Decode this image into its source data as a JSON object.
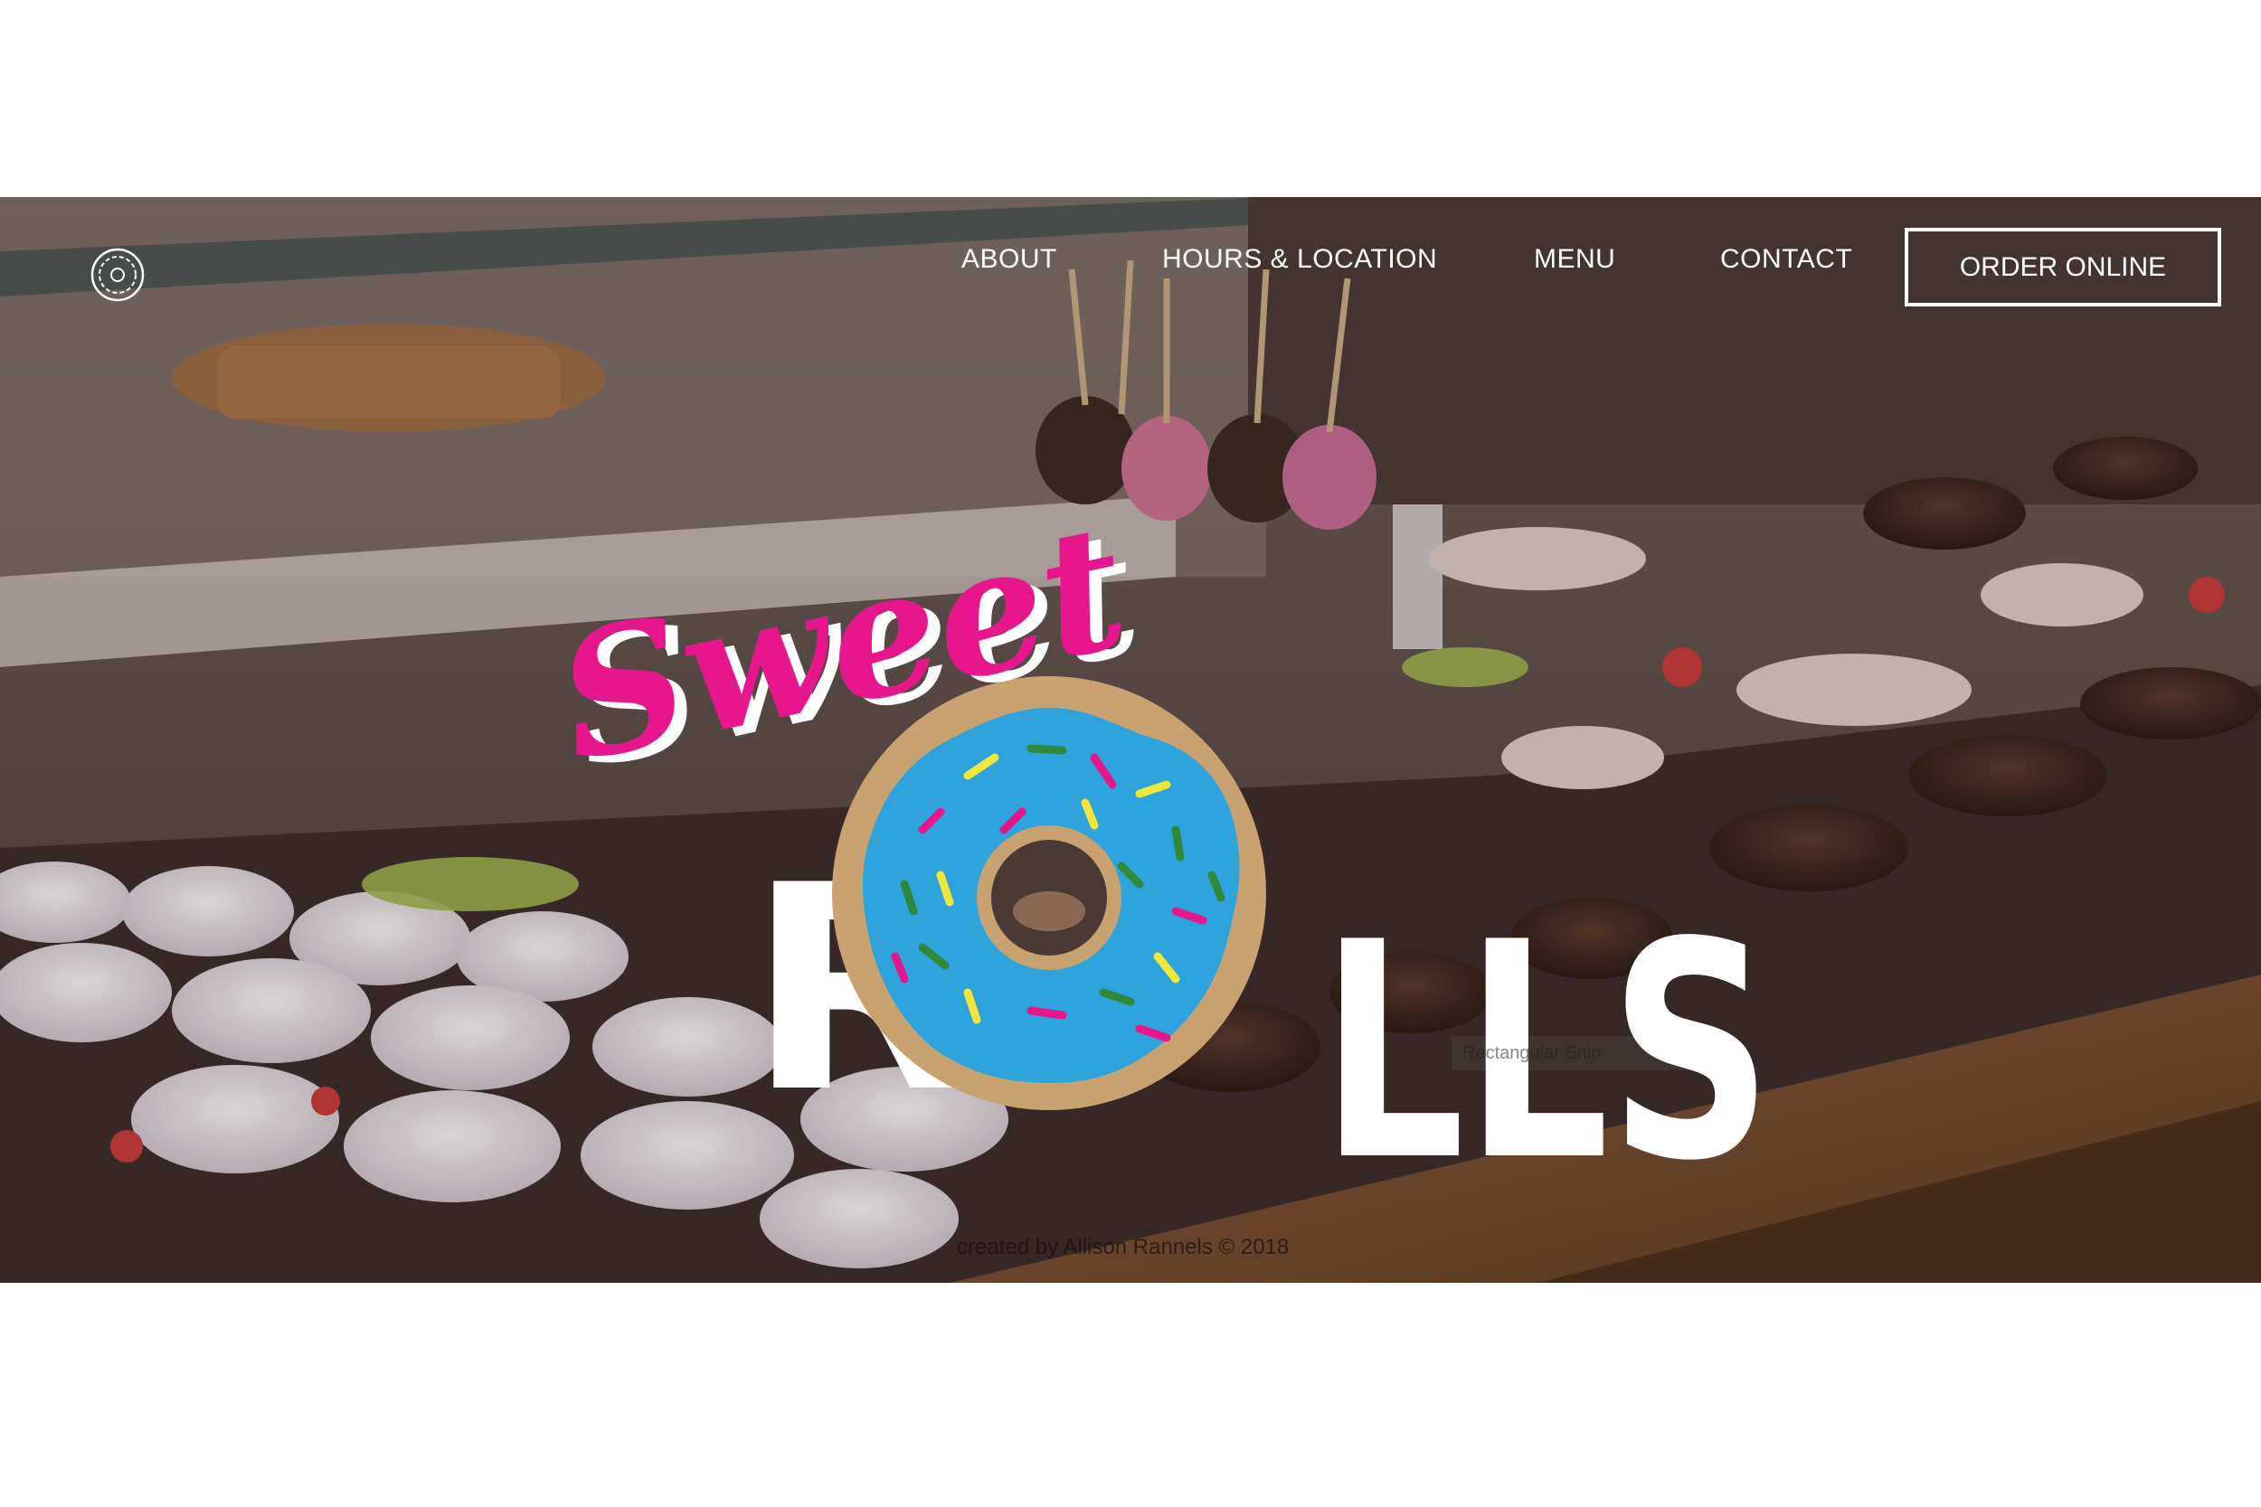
{
  "nav": {
    "items": [
      {
        "label": "ABOUT"
      },
      {
        "label": "HOURS & LOCATION"
      },
      {
        "label": "MENU"
      },
      {
        "label": "CONTACT"
      }
    ],
    "cta_label": "ORDER ONLINE",
    "logo_icon": "donut-icon"
  },
  "hero": {
    "brand_script": "Sweet",
    "brand_block": "ROLLS",
    "brand_block_letters": [
      "R",
      "LLS"
    ],
    "caption": "Rectangular Snip",
    "credit": "created by Allison Rannels © 2018"
  },
  "colors": {
    "brand_pink": "#e8168c",
    "donut_icing": "#2ea3dc",
    "donut_dough": "#c9a272",
    "text_white": "#ffffff"
  }
}
